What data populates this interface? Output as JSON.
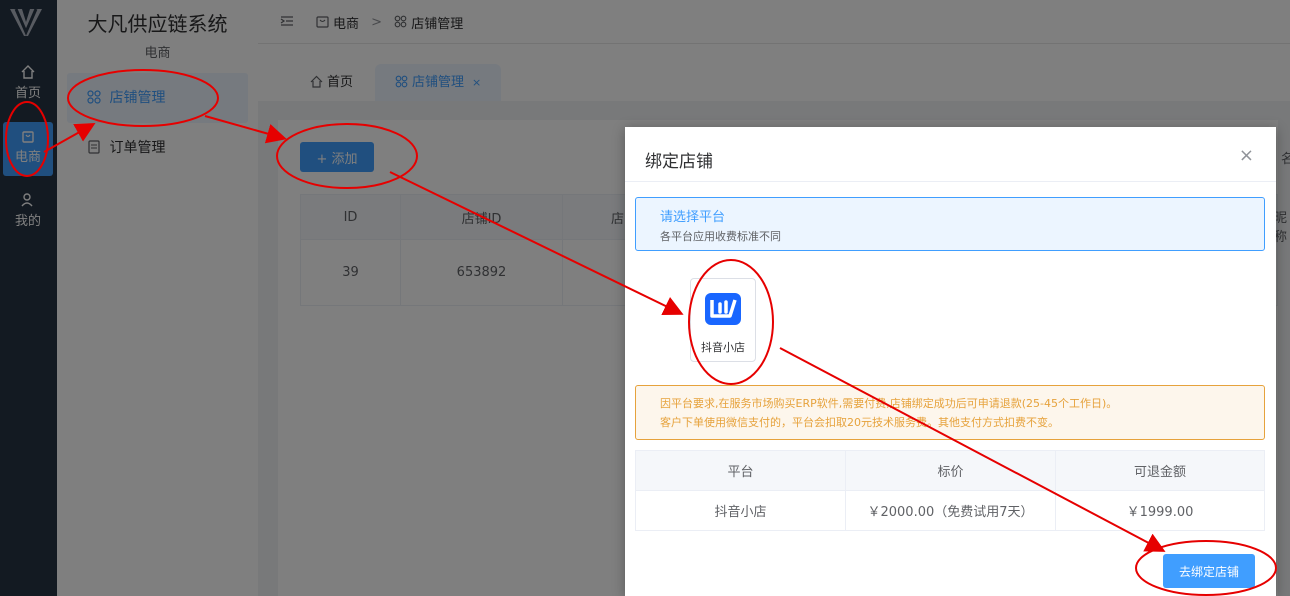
{
  "rail": {
    "logo_icon": "v-logo-icon",
    "items": [
      {
        "label": "首页",
        "icon": "home-icon"
      },
      {
        "label": "电商",
        "icon": "shop-bag-icon"
      },
      {
        "label": "我的",
        "icon": "user-icon"
      }
    ]
  },
  "subnav": {
    "title": "大凡供应链系统",
    "subtitle": "电商",
    "items": [
      {
        "label": "店铺管理",
        "icon": "grid-icon"
      },
      {
        "label": "订单管理",
        "icon": "document-icon"
      }
    ]
  },
  "header": {
    "breadcrumb": [
      "电商",
      "店铺管理"
    ],
    "breadcrumb_sep": ">"
  },
  "tabs": [
    {
      "label": "首页"
    },
    {
      "label": "店铺管理",
      "close": "×"
    }
  ],
  "content": {
    "add_button": "+ 添加",
    "table": {
      "headers": [
        "ID",
        "店铺ID",
        "店"
      ],
      "rows": [
        [
          "39",
          "653892",
          ""
        ]
      ]
    },
    "edge_text": [
      "名",
      "昵称"
    ]
  },
  "dialog": {
    "title": "绑定店铺",
    "close": "×",
    "info_title": "请选择平台",
    "info_desc": "各平台应用收费标准不同",
    "platform_label": "抖音小店",
    "warning_line1": "因平台要求,在服务市场购买ERP软件,需要付费,店铺绑定成功后可申请退款(25-45个工作日)。",
    "warning_line2": "客户下单使用微信支付的，平台会扣取20元技术服务费。其他支付方式扣费不变。",
    "price_table": {
      "headers": [
        "平台",
        "标价",
        "可退金额"
      ],
      "rows": [
        [
          "抖音小店",
          "￥2000.00（免费试用7天）",
          "￥1999.00"
        ]
      ]
    },
    "bind_button": "去绑定店铺"
  },
  "colors": {
    "primary": "#409eff",
    "rail_bg": "#263445",
    "warning": "#e6a23c",
    "annotation": "#e60000"
  }
}
